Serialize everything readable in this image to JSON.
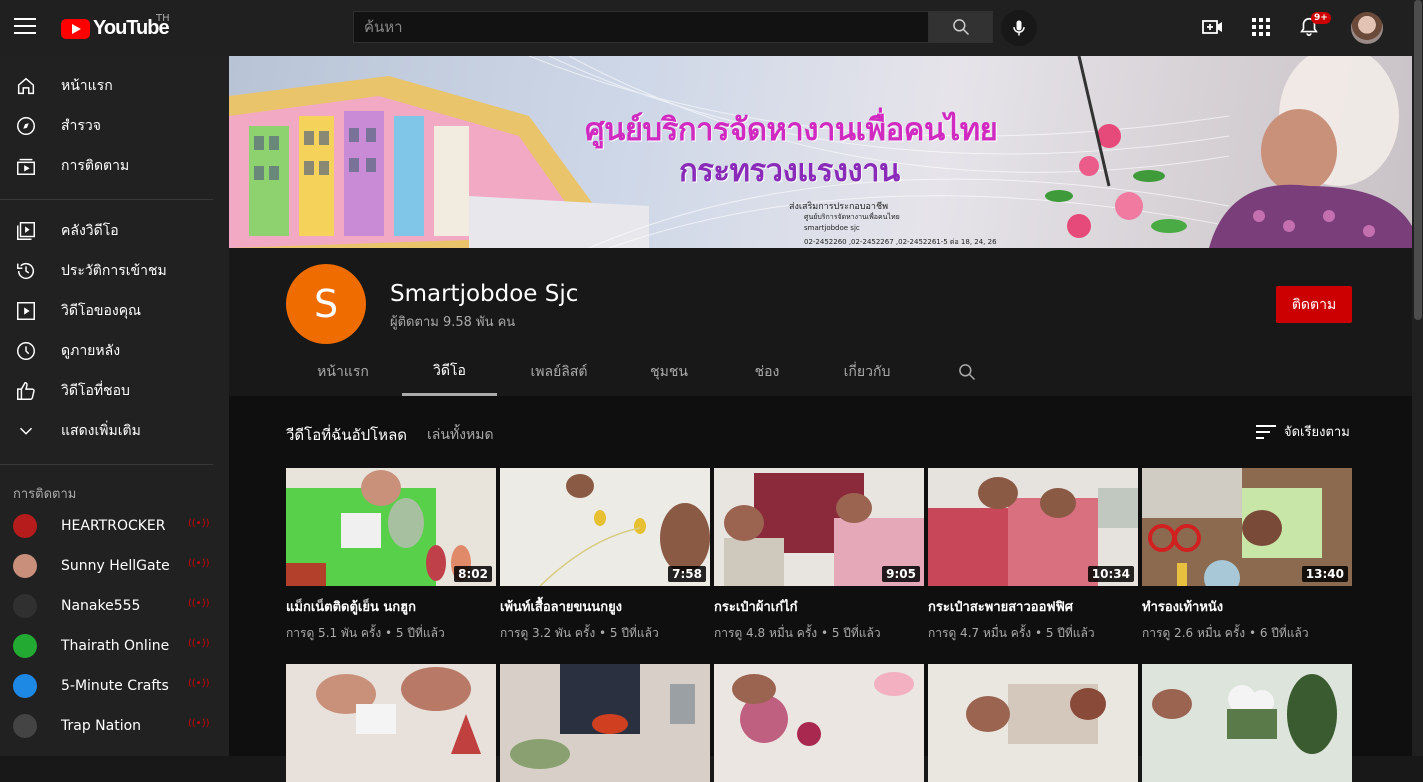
{
  "topbar": {
    "logo_text": "YouTube",
    "country": "TH",
    "search_placeholder": "ค้นหา",
    "notification_count": "9+"
  },
  "sidebar": {
    "main_items": [
      {
        "label": "หน้าแรก",
        "icon": "home-icon"
      },
      {
        "label": "สำรวจ",
        "icon": "compass-icon"
      },
      {
        "label": "การติดตาม",
        "icon": "subscriptions-icon"
      }
    ],
    "library_items": [
      {
        "label": "คลังวิดีโอ",
        "icon": "library-icon"
      },
      {
        "label": "ประวัติการเข้าชม",
        "icon": "history-icon"
      },
      {
        "label": "วิดีโอของคุณ",
        "icon": "your-videos-icon"
      },
      {
        "label": "ดูภายหลัง",
        "icon": "clock-icon"
      },
      {
        "label": "วิดีโอที่ชอบ",
        "icon": "thumbs-up-icon"
      },
      {
        "label": "แสดงเพิ่มเติม",
        "icon": "chevron-down-icon"
      }
    ],
    "subscriptions_heading": "การติดตาม",
    "subscriptions": [
      {
        "label": "HEARTROCKER",
        "color": "#b71c1c"
      },
      {
        "label": "Sunny HellGate",
        "color": "#c98f7a"
      },
      {
        "label": "Nanake555",
        "color": "#303030"
      },
      {
        "label": "Thairath Online",
        "color": "#22aa33"
      },
      {
        "label": "5-Minute Crafts",
        "color": "#1e88e5"
      },
      {
        "label": "Trap Nation",
        "color": "#444444"
      }
    ]
  },
  "banner": {
    "title_line1": "ศูนย์บริการจัดหางานเพื่อคนไทย",
    "title_line2": "กระทรวงแรงงาน",
    "small_lines": [
      "ส่งเสริมการประกอบอาชีพ",
      "ศูนย์บริการจัดหางานเพื่อคนไทย",
      "smartjobdoe sjc",
      "02-2452260 ,02-2452267 ,02-2452261-5 ต่อ 18, 24, 26"
    ]
  },
  "channel": {
    "avatar_letter": "S",
    "name": "Smartjobdoe Sjc",
    "subscribers": "ผู้ติดตาม 9.58 พัน คน",
    "subscribe_label": "ติดตาม",
    "tabs": [
      "หน้าแรก",
      "วิดีโอ",
      "เพลย์ลิสต์",
      "ชุมชน",
      "ช่อง",
      "เกี่ยวกับ"
    ],
    "active_tab": "วิดีโอ"
  },
  "section": {
    "title": "วีดีโอที่ฉันอัปโหลด",
    "play_all": "เล่นทั้งหมด",
    "sort_label": "จัดเรียงตาม"
  },
  "videos": [
    {
      "title": "แม็กเน็ตติดตู้เย็น นกฮูก",
      "duration": "8:02",
      "meta": "การดู 5.1 พัน ครั้ง • 5 ปีที่แล้ว",
      "bg": "#58d04a"
    },
    {
      "title": "เพ้นท์เสื้อลายขนนกยูง",
      "duration": "7:58",
      "meta": "การดู 3.2 พัน ครั้ง • 5 ปีที่แล้ว",
      "bg": "#e8e6e0"
    },
    {
      "title": "กระเป๋าผ้าเก๋ไก๋",
      "duration": "9:05",
      "meta": "การดู 4.8 หมื่น ครั้ง • 5 ปีที่แล้ว",
      "bg": "#8a2a3a"
    },
    {
      "title": "กระเป๋าสะพายสาวออฟฟิศ",
      "duration": "10:34",
      "meta": "การดู 4.7 หมื่น ครั้ง • 5 ปีที่แล้ว",
      "bg": "#b04a55"
    },
    {
      "title": "ทำรองเท้าหนัง",
      "duration": "13:40",
      "meta": "การดู 2.6 หมื่น ครั้ง • 6 ปีที่แล้ว",
      "bg": "#8b6a50"
    }
  ],
  "videos_row2": [
    {
      "bg": "#e8d8d0"
    },
    {
      "bg": "#3a3a3a"
    },
    {
      "bg": "#c06080"
    },
    {
      "bg": "#d8d4cc"
    },
    {
      "bg": "#d8e0d8"
    }
  ]
}
